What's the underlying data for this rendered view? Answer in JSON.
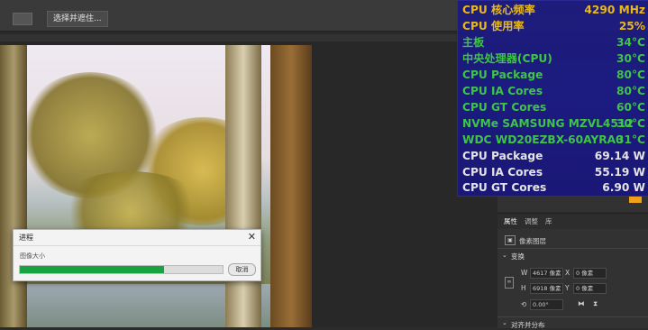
{
  "toolbar": {
    "select_mask_label": "选择并遮住..."
  },
  "hardware_monitor": {
    "rows": [
      {
        "label": "CPU 核心频率",
        "value": "4290 MHz",
        "color": "#f6c21a"
      },
      {
        "label": "CPU 使用率",
        "value": "25%",
        "color": "#f6c21a"
      },
      {
        "label": "主板",
        "value": "34°C",
        "color": "#42d04a"
      },
      {
        "label": "中央处理器(CPU)",
        "value": "30°C",
        "color": "#42d04a"
      },
      {
        "label": "CPU Package",
        "value": "80°C",
        "color": "#42d04a"
      },
      {
        "label": "CPU IA Cores",
        "value": "80°C",
        "color": "#42d04a"
      },
      {
        "label": "CPU GT Cores",
        "value": "60°C",
        "color": "#42d04a"
      },
      {
        "label": "NVMe SAMSUNG MZVL4512",
        "value": "30°C",
        "color": "#42d04a"
      },
      {
        "label": "WDC WD20EZBX-60AYRA0",
        "value": "31°C",
        "color": "#42d04a"
      },
      {
        "label": "CPU Package",
        "value": "69.14 W",
        "color": "#f2f2f2"
      },
      {
        "label": "CPU IA Cores",
        "value": "55.19 W",
        "color": "#f2f2f2"
      },
      {
        "label": "CPU GT Cores",
        "value": "6.90 W",
        "color": "#f2f2f2"
      }
    ]
  },
  "properties_panel": {
    "tabs": [
      "属性",
      "调整",
      "库"
    ],
    "layer_type": "像素图层",
    "transform_section": "变换",
    "width_value": "4617 像素",
    "height_value": "6918 像素",
    "x_value": "0 像素",
    "y_value": "0 像素",
    "width_label": "W",
    "height_label": "H",
    "x_label": "X",
    "y_label": "Y",
    "angle_value": "0.00°",
    "align_section": "对齐并分布"
  },
  "progress_dialog": {
    "title": "进程",
    "status": "图像大小",
    "progress": 0.71,
    "cancel_label": "取消"
  }
}
